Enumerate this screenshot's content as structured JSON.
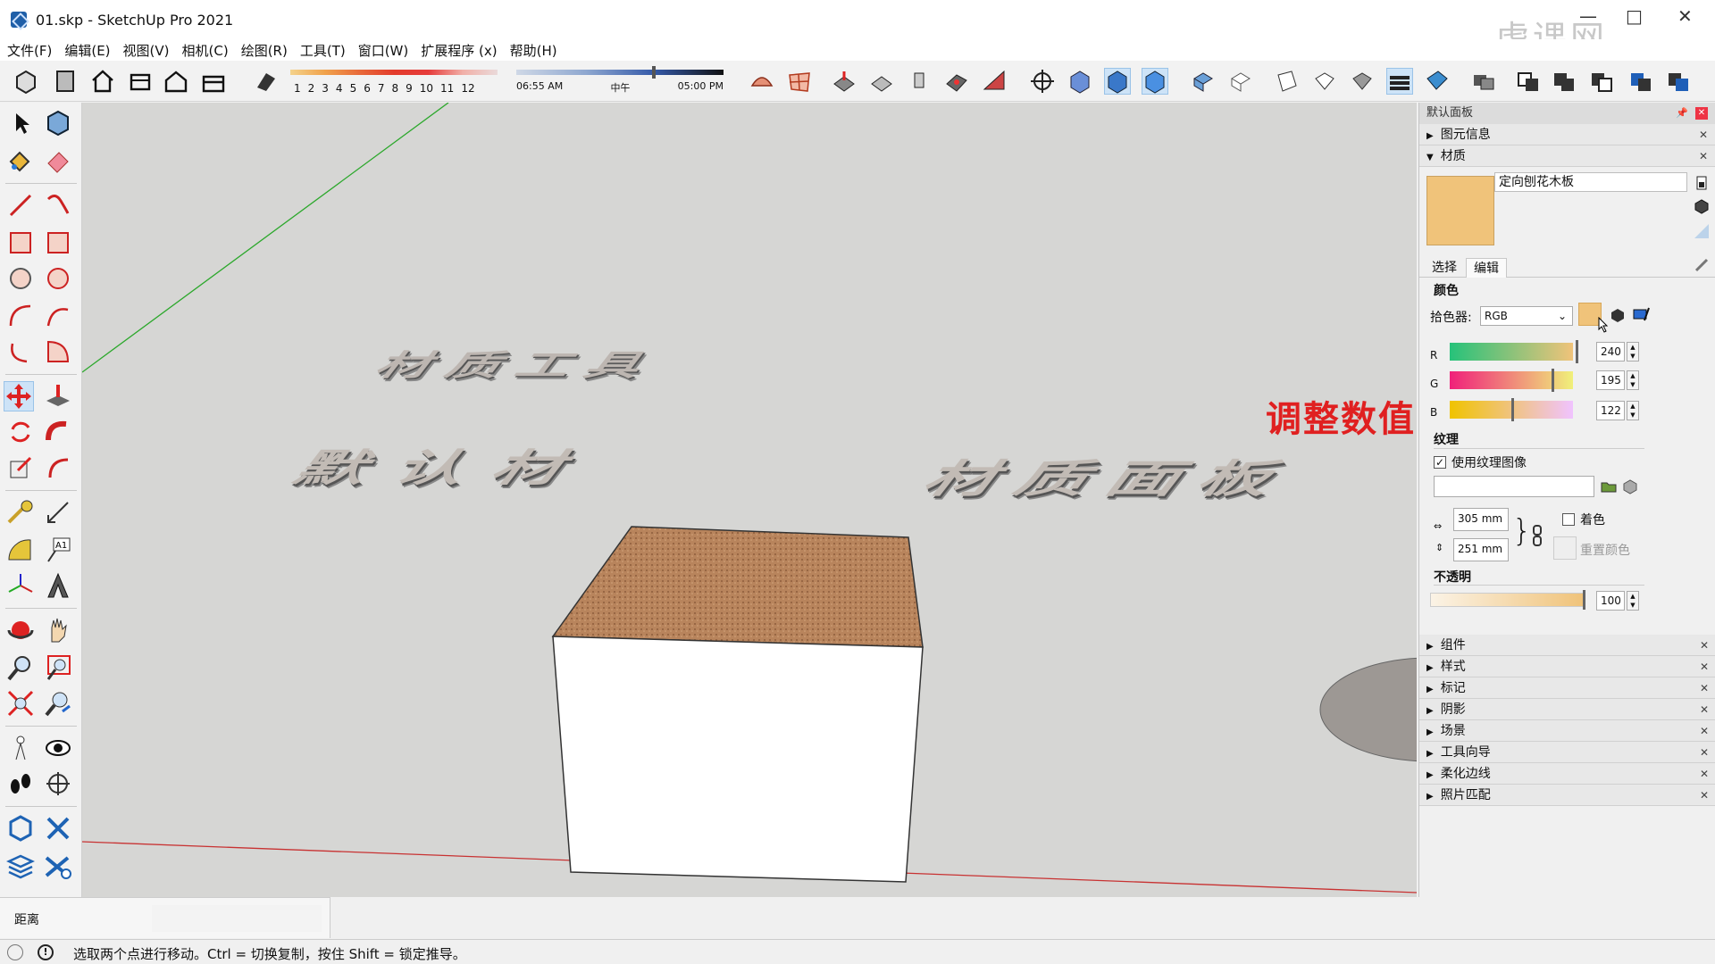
{
  "window": {
    "title": "01.skp - SketchUp Pro 2021",
    "watermark": "虎课网"
  },
  "menu": [
    "文件(F)",
    "编辑(E)",
    "视图(V)",
    "相机(C)",
    "绘图(R)",
    "工具(T)",
    "窗口(W)",
    "扩展程序 (x)",
    "帮助(H)"
  ],
  "shadow_settings": {
    "months": [
      "1",
      "2",
      "3",
      "4",
      "5",
      "6",
      "7",
      "8",
      "9",
      "10",
      "11",
      "12"
    ],
    "time_start": "06:55 AM",
    "time_mid": "中午",
    "time_end": "05:00 PM"
  },
  "scene": {
    "text_line1": "材质工具",
    "text_line2a": "默认材",
    "text_line2b": "材质面板",
    "annotation": "调整数值"
  },
  "panel": {
    "title": "默认面板",
    "sections_top": [
      {
        "label": "图元信息",
        "expanded": false
      },
      {
        "label": "材质",
        "expanded": true
      }
    ],
    "material": {
      "name": "定向刨花木板",
      "swatch_color": "#f0c37a",
      "tab_select": "选择",
      "tab_edit": "编辑",
      "color_heading": "颜色",
      "picker_label": "拾色器:",
      "picker_value": "RGB",
      "r_label": "R",
      "g_label": "G",
      "b_label": "B",
      "r": 240,
      "g": 195,
      "b": 122,
      "texture_heading": "纹理",
      "use_texture_label": "使用纹理图像",
      "use_texture_checked": true,
      "texture_path": "",
      "width": "305 mm",
      "height": "251 mm",
      "colorize_label": "着色",
      "reset_color_label": "重置颜色",
      "opacity_heading": "不透明",
      "opacity": 100
    },
    "sections_bottom": [
      {
        "label": "组件"
      },
      {
        "label": "样式"
      },
      {
        "label": "标记"
      },
      {
        "label": "阴影"
      },
      {
        "label": "场景"
      },
      {
        "label": "工具向导"
      },
      {
        "label": "柔化边线"
      },
      {
        "label": "照片匹配"
      }
    ]
  },
  "measurements": {
    "label": "距离",
    "value": ""
  },
  "status_bar": {
    "message": "选取两个点进行移动。Ctrl = 切换复制，按住 Shift = 锁定推导。"
  }
}
